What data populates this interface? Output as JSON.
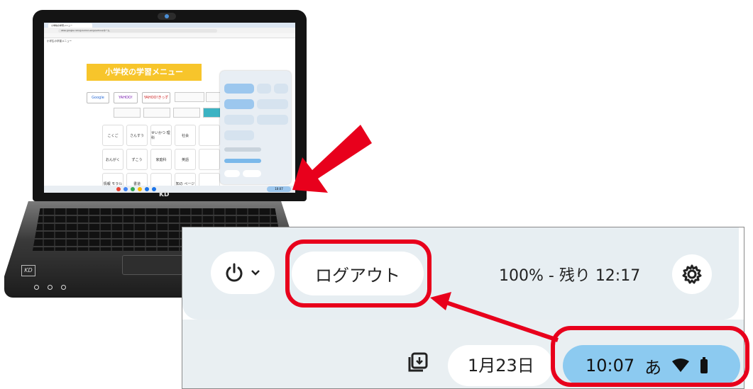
{
  "laptop": {
    "brand_logo": "KD",
    "screen": {
      "tab_title": "小学校の学習メニュー",
      "url": "sites.google.com/g.kumon-ed.jp/school/ホーム",
      "site_name": "小学生の学習メニュー",
      "banner_title": "小学校の学習メニュー",
      "search_links": [
        "Google",
        "YAHOO!",
        "YAHOO!きっず"
      ],
      "subject_buttons": [
        "こくご",
        "さんすう",
        "せいかつ 理科",
        "社会",
        "おんがく",
        "ずこう",
        "家庭科",
        "英語",
        "情報 モラル",
        "書道",
        "知の ページ"
      ]
    }
  },
  "quick_settings": {
    "power_icon": "power-icon",
    "chevron_icon": "chevron-down-icon",
    "logout_label": "ログアウト",
    "battery_status": "100% - 残り 12:17",
    "settings_icon": "gear-icon"
  },
  "shelf": {
    "holding_space_icon": "holding-space-icon",
    "date": "1月23日",
    "time": "10:07",
    "ime": "あ",
    "wifi_icon": "wifi-icon",
    "battery_icon": "battery-icon"
  },
  "colors": {
    "highlight_red": "#e8001c",
    "clock_pill_blue": "#8ccaf0",
    "panel_bg": "#e7eef2"
  }
}
